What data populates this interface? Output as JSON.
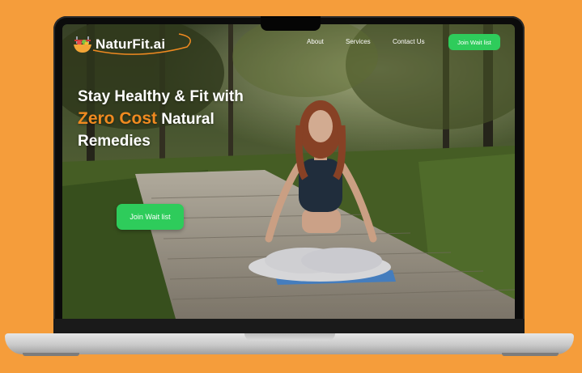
{
  "brand": {
    "name": "NaturFit.ai"
  },
  "nav": {
    "links": [
      "About",
      "Services",
      "Contact Us"
    ],
    "cta_label": "Join Wait list"
  },
  "hero": {
    "line1": "Stay Healthy & Fit with",
    "accent": "Zero Cost",
    "line2_rest": " Natural",
    "line3": "Remedies",
    "cta_label": "Join Wait list"
  },
  "colors": {
    "background": "#f59d3b",
    "accent_orange": "#f08a20",
    "button_green": "#2ecc5b"
  },
  "icons": [
    "salad-bowl-logo-icon"
  ]
}
